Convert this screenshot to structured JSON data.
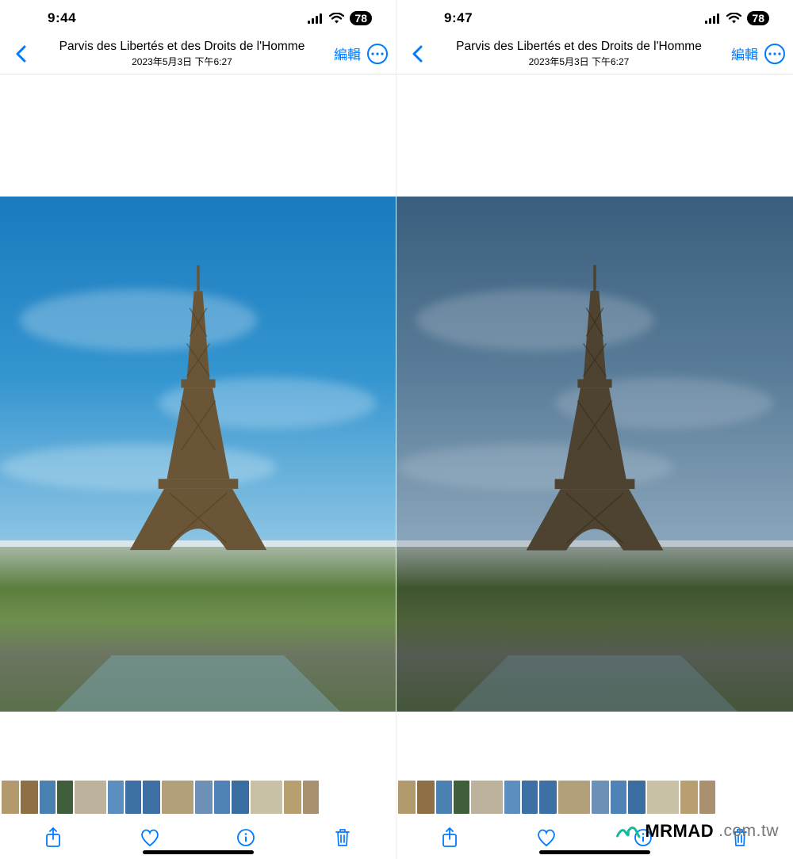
{
  "panes": [
    {
      "status_time": "9:44",
      "battery": "78"
    },
    {
      "status_time": "9:47",
      "battery": "78"
    }
  ],
  "header": {
    "title": "Parvis des Libertés et des Droits de l'Homme",
    "subtitle": "2023年5月3日 下午6:27",
    "edit_label": "編輯"
  },
  "watermark": {
    "brand_bold": "MRMAD",
    "brand_rest": ".com.tw"
  },
  "thumb_colors": [
    "#b29a6e",
    "#8e6f46",
    "#4a81b0",
    "#3e5f3a",
    "#bdb39c",
    "#5d8ec0",
    "#3d71a5",
    "#3d71a5",
    "#b2a07a",
    "#6d91b6",
    "#4f83b8",
    "#3a6da0",
    "#c9c1a6",
    "#b79f70",
    "#a89070",
    "#b29a6e",
    "#8e6f46",
    "#4a81b0",
    "#3e5f3a",
    "#bdb39c",
    "#5d8ec0",
    "#3d71a5",
    "#3d71a5",
    "#b2a07a",
    "#6d91b6",
    "#4f83b8",
    "#3a6da0",
    "#c9c1a6",
    "#b79f70",
    "#a89070"
  ],
  "thumb_widths": [
    22,
    22,
    20,
    20,
    40,
    20,
    20,
    22,
    40,
    22,
    20,
    22,
    40,
    22,
    20,
    22,
    22,
    20,
    20,
    40,
    20,
    20,
    22,
    40,
    22,
    20,
    22,
    40,
    22,
    20
  ]
}
